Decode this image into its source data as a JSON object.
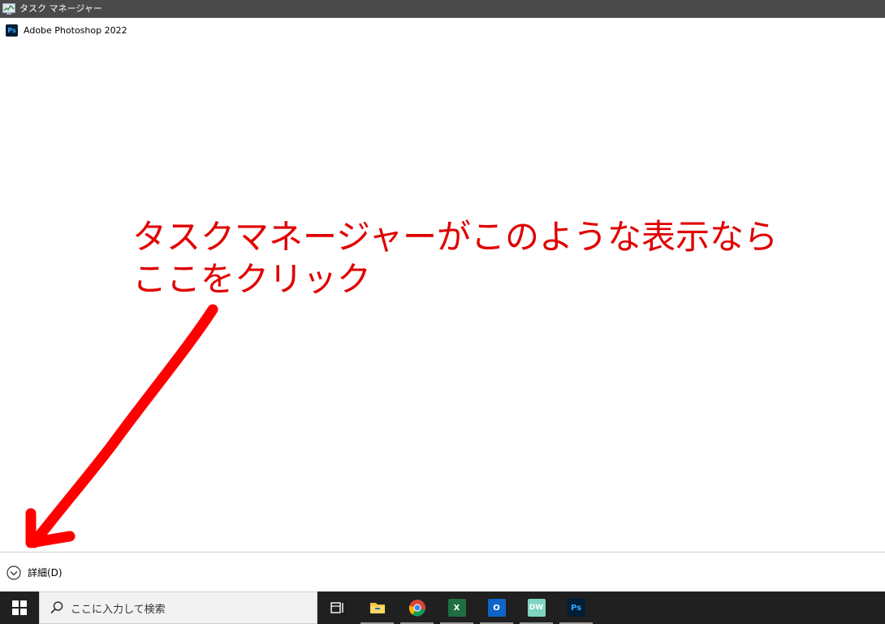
{
  "window": {
    "title": "タスク マネージャー"
  },
  "processes": [
    {
      "name": "Adobe Photoshop 2022",
      "icon": "photoshop-icon",
      "icon_text": "Ps"
    }
  ],
  "annotation": {
    "line1": "タスクマネージャーがこのような表示なら",
    "line2": "ここをクリック",
    "color": "#e00000"
  },
  "details": {
    "label": "詳細(D)",
    "icon": "chevron-down-circle-icon"
  },
  "taskbar": {
    "search_placeholder": "ここに入力して検索",
    "apps": [
      {
        "name": "task-view",
        "icon": "task-view-icon"
      },
      {
        "name": "file-explorer",
        "icon": "folder-icon"
      },
      {
        "name": "chrome",
        "icon": "chrome-icon"
      },
      {
        "name": "excel",
        "icon": "excel-icon",
        "icon_text": "X"
      },
      {
        "name": "outlook",
        "icon": "outlook-icon",
        "icon_text": "O"
      },
      {
        "name": "dreamweaver",
        "icon": "dreamweaver-icon",
        "icon_text": "DW"
      },
      {
        "name": "photoshop",
        "icon": "photoshop-icon",
        "icon_text": "Ps"
      }
    ]
  }
}
